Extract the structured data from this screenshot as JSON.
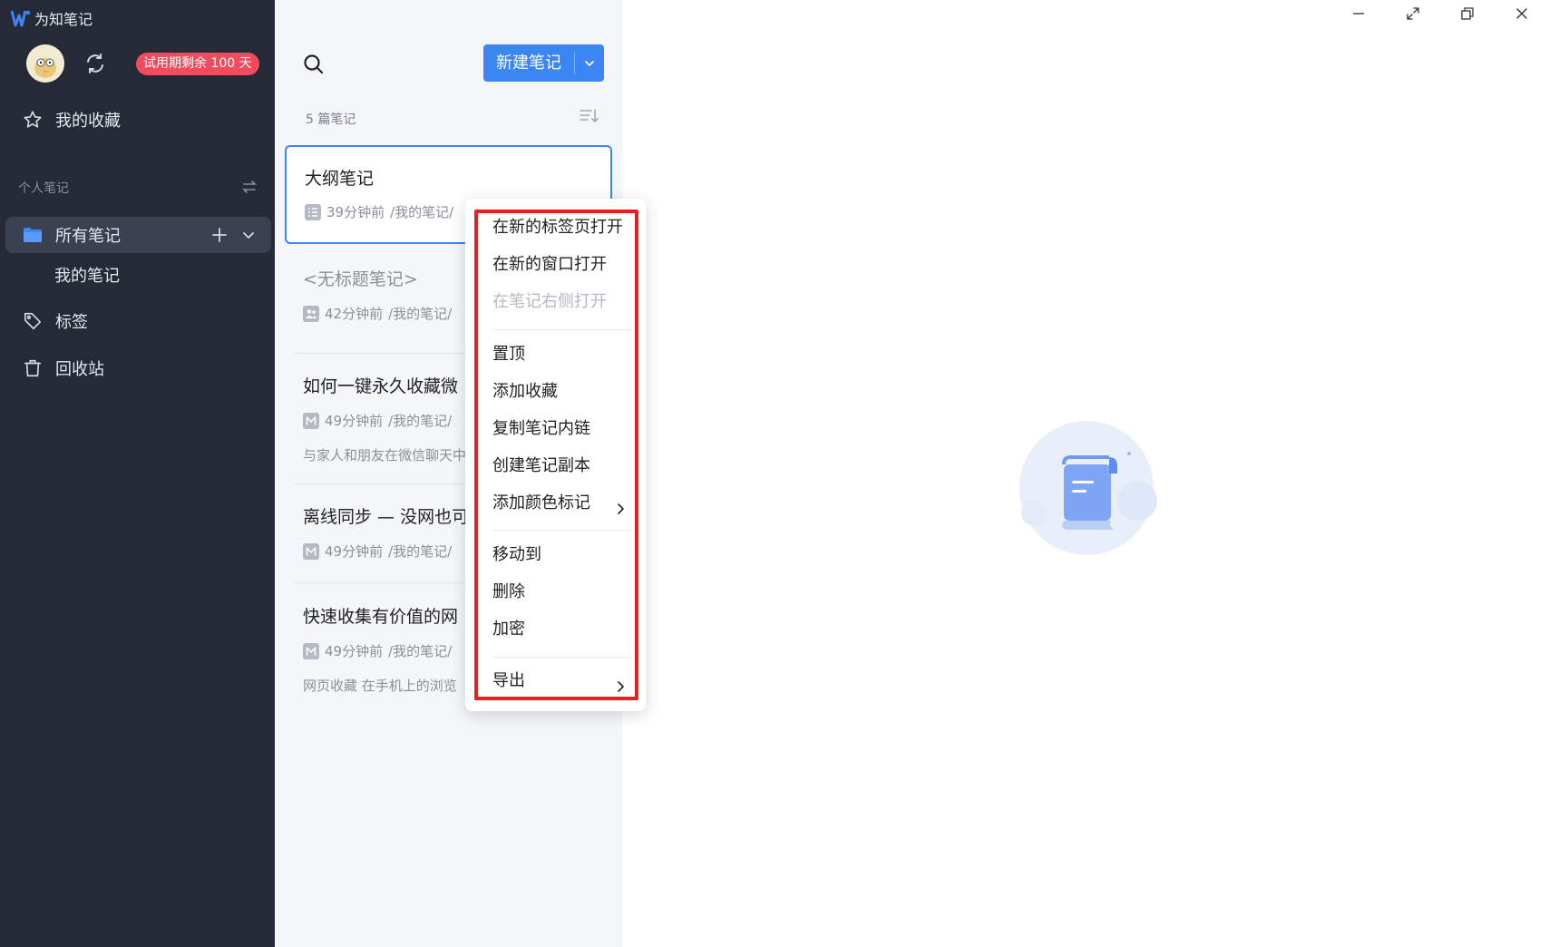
{
  "app": {
    "title": "为知笔记"
  },
  "user": {
    "trial_badge": "试用期剩余 100 天"
  },
  "sidebar": {
    "favorites": "我的收藏",
    "section_label": "个人笔记",
    "all_notes": "所有笔记",
    "my_notes": "我的笔记",
    "tags": "标签",
    "trash": "回收站"
  },
  "list": {
    "new_note": "新建笔记",
    "count": "5 篇笔记",
    "notes": [
      {
        "title": "大纲笔记",
        "time": "39分钟前",
        "path": "/我的笔记/",
        "type_icon": "outline-icon"
      },
      {
        "title": "<无标题笔记>",
        "time": "42分钟前",
        "path": "/我的笔记/",
        "type_icon": "collab-icon"
      },
      {
        "title": "如何一键永久收藏微",
        "time": "49分钟前",
        "path": "/我的笔记/",
        "type_icon": "markdown-icon",
        "snippet": "与家人和朋友在微信聊天中"
      },
      {
        "title": "离线同步 — 没网也可",
        "time": "49分钟前",
        "path": "/我的笔记/",
        "type_icon": "markdown-icon"
      },
      {
        "title": "快速收集有价值的网",
        "time": "49分钟前",
        "path": "/我的笔记/",
        "type_icon": "markdown-icon",
        "snippet": "网页收藏 在手机上的浏览"
      }
    ]
  },
  "context_menu": {
    "items": [
      {
        "label": "在新的标签页打开",
        "enabled": true
      },
      {
        "label": "在新的窗口打开",
        "enabled": true
      },
      {
        "label": "在笔记右侧打开",
        "enabled": false
      },
      {
        "label": "置顶",
        "enabled": true
      },
      {
        "label": "添加收藏",
        "enabled": true
      },
      {
        "label": "复制笔记内链",
        "enabled": true
      },
      {
        "label": "创建笔记副本",
        "enabled": true
      },
      {
        "label": "添加颜色标记",
        "enabled": true,
        "submenu": true
      },
      {
        "label": "移动到",
        "enabled": true
      },
      {
        "label": "删除",
        "enabled": true
      },
      {
        "label": "加密",
        "enabled": true
      },
      {
        "label": "导出",
        "enabled": true,
        "submenu": true
      }
    ]
  },
  "colors": {
    "sidebar_bg": "#252a36",
    "accent": "#3b85f5",
    "badge": "#f04c5e",
    "highlight_box": "#ee1d1d"
  }
}
